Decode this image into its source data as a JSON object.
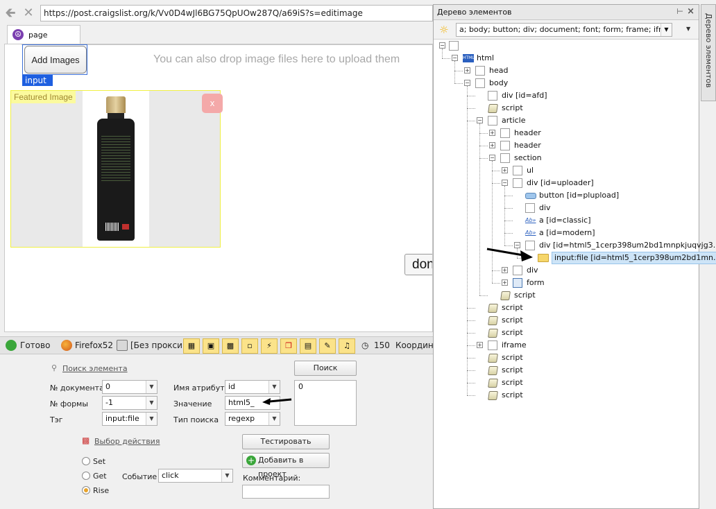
{
  "browser": {
    "url": "https://post.craigslist.org/k/Vv0D4wJl6BG75QpUOw287Q/a69iS?s=editimage",
    "tab_label": "page"
  },
  "webpage": {
    "add_images_label": "Add Images",
    "input_tag": "input",
    "drop_hint": "You can also drop image files here to upload them",
    "featured_label": "Featured Image",
    "delete_label": "x",
    "done_label": "don"
  },
  "statusbar": {
    "ready": "Готово",
    "browser": "Firefox52",
    "proxy": "[Без прокси]",
    "timer": "150",
    "coords": "Координа"
  },
  "form": {
    "search_link": "Поиск элемента",
    "search_button": "Поиск",
    "doc_label": "№ документа",
    "doc_value": "0",
    "form_label": "№ формы",
    "form_value": "-1",
    "tag_label": "Тэг",
    "tag_value": "input:file",
    "attr_label": "Имя атрибута",
    "attr_value": "id",
    "value_label": "Значение",
    "value_value": "html5_",
    "search_type_label": "Тип поиска",
    "search_type_value": "regexp",
    "results": [
      "0"
    ],
    "action_link": "Выбор действия",
    "test_button": "Тестировать",
    "add_button": "Добавить в проект",
    "comment_label": "Комментарий:",
    "comment_value": "",
    "radio_set": "Set",
    "radio_get": "Get",
    "radio_rise": "Rise",
    "selected_radio": "Rise",
    "event_label": "Событие",
    "event_value": "click"
  },
  "tree": {
    "title": "Дерево элементов",
    "filter": "a; body; button; div; document; font; form; frame; iframe; ...",
    "side_tab": "Дерево элементов",
    "nodes": [
      {
        "label": "html",
        "icon": "html"
      },
      {
        "label": "head",
        "icon": "box"
      },
      {
        "label": "body",
        "icon": "box"
      },
      {
        "label": "div [id=afd]",
        "icon": "box"
      },
      {
        "label": "script",
        "icon": "script"
      },
      {
        "label": "article",
        "icon": "box"
      },
      {
        "label": "header",
        "icon": "box"
      },
      {
        "label": "header",
        "icon": "box"
      },
      {
        "label": "section",
        "icon": "box"
      },
      {
        "label": "ul",
        "icon": "box"
      },
      {
        "label": "div [id=uploader]",
        "icon": "box"
      },
      {
        "label": "button [id=plupload]",
        "icon": "button"
      },
      {
        "label": "div",
        "icon": "box"
      },
      {
        "label": "a [id=classic]",
        "icon": "link"
      },
      {
        "label": "a [id=modern]",
        "icon": "link"
      },
      {
        "label": "div [id=html5_1cerp398um2bd1mnpkjuqvjg3...",
        "icon": "box"
      },
      {
        "label": "input:file [id=html5_1cerp398um2bd1mn...",
        "icon": "folder"
      },
      {
        "label": "div",
        "icon": "box"
      },
      {
        "label": "form",
        "icon": "form"
      },
      {
        "label": "script",
        "icon": "script"
      },
      {
        "label": "script",
        "icon": "script"
      },
      {
        "label": "script",
        "icon": "script"
      },
      {
        "label": "script",
        "icon": "script"
      },
      {
        "label": "iframe",
        "icon": "box"
      },
      {
        "label": "script",
        "icon": "script"
      },
      {
        "label": "script",
        "icon": "script"
      },
      {
        "label": "script",
        "icon": "script"
      },
      {
        "label": "script",
        "icon": "script"
      }
    ]
  },
  "colors": {
    "accent": "#1e5fe0",
    "selection": "#cde4f7",
    "featured_border": "#f0f044",
    "delete_button": "#f4a9a9"
  }
}
